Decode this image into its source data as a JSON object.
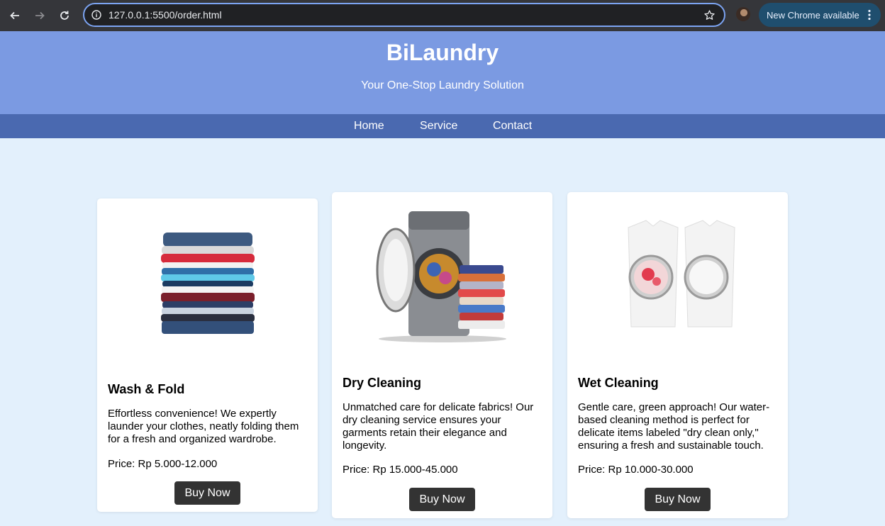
{
  "browser": {
    "url": "127.0.0.1:5500/order.html",
    "update_label": "New Chrome available"
  },
  "header": {
    "title": "BiLaundry",
    "tagline": "Your One-Stop Laundry Solution"
  },
  "nav": {
    "items": [
      {
        "label": "Home"
      },
      {
        "label": "Service"
      },
      {
        "label": "Contact"
      }
    ]
  },
  "cards": [
    {
      "title": "Wash & Fold",
      "description": "Effortless convenience! We expertly launder your clothes, neatly folding them for a fresh and organized wardrobe.",
      "price": "Price: Rp 5.000-12.000",
      "button": "Buy Now"
    },
    {
      "title": "Dry Cleaning",
      "description": "Unmatched care for delicate fabrics! Our dry cleaning service ensures your garments retain their elegance and longevity.",
      "price": "Price: Rp 15.000-45.000",
      "button": "Buy Now"
    },
    {
      "title": "Wet Cleaning",
      "description": "Gentle care, green approach! Our water-based cleaning method is perfect for delicate items labeled \"dry clean only,\" ensuring a fresh and sustainable touch.",
      "price": "Price: Rp 10.000-30.000",
      "button": "Buy Now"
    }
  ],
  "colors": {
    "header_bg": "#7b9ae2",
    "nav_bg": "#4a69b0",
    "page_bg": "#e3f0fc",
    "button_bg": "#333333"
  },
  "icons": [
    "back-arrow-icon",
    "forward-arrow-icon",
    "reload-icon",
    "info-icon",
    "bookmark-star-icon",
    "kebab-menu-icon"
  ]
}
